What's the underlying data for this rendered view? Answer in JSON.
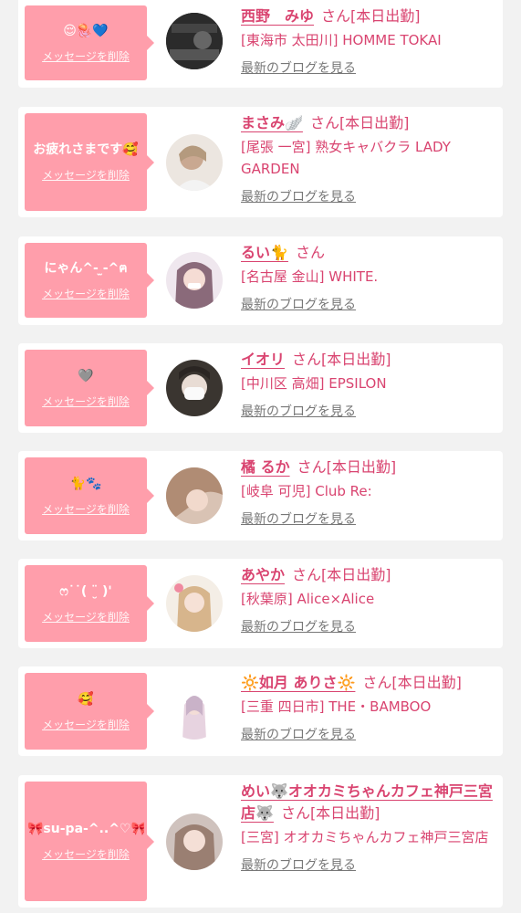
{
  "common": {
    "delete_label": "メッセージを削除",
    "blog_label": "最新のブログを見る"
  },
  "colors": {
    "accent": "#d94470",
    "bubble": "#ff9eab",
    "background": "#f2f2f2",
    "card": "#ffffff"
  },
  "cards": [
    {
      "message": "😌🪼💙",
      "name": "西野　みゆ",
      "san": "さん[本日出勤]",
      "shop": "[東海市 太田川] HOMME TOKAI",
      "avatar_text": "HOMME TOKAI"
    },
    {
      "message": "お疲れさまです🥰",
      "name": "まさみ🪽",
      "san": "さん[本日出勤]",
      "shop": "[尾張 一宮] 熟女キャバクラ LADY GARDEN"
    },
    {
      "message": "にゃん^- ̫-^ฅ",
      "name": "るい🐈",
      "san": "さん",
      "shop": "[名古屋 金山] WHITE."
    },
    {
      "message": "🩶",
      "name": "イオリ",
      "san": "さん[本日出勤]",
      "shop": "[中川区 高畑] EPSILON"
    },
    {
      "message": "🐈🐾",
      "name": "橘 るか",
      "san": "さん[本日出勤]",
      "shop": "[岐阜 可児] Club Re:"
    },
    {
      "message": "ෆ˙˙( ¨̮ )'",
      "name": "あやか",
      "san": "さん[本日出勤]",
      "shop": "[秋葉原] Alice×Alice"
    },
    {
      "message": "🥰",
      "name": "🔆如月 ありさ🔆",
      "san": "さん[本日出勤]",
      "shop": "[三重 四日市] THE・BAMBOO"
    },
    {
      "message": "🎀su-pa-^..^♡🎀",
      "name": "めい🐺オオカミちゃんカフェ神戸三宮店🐺",
      "san": "さん[本日出勤]",
      "shop": "[三宮] オオカミちゃんカフェ神戸三宮店"
    }
  ]
}
